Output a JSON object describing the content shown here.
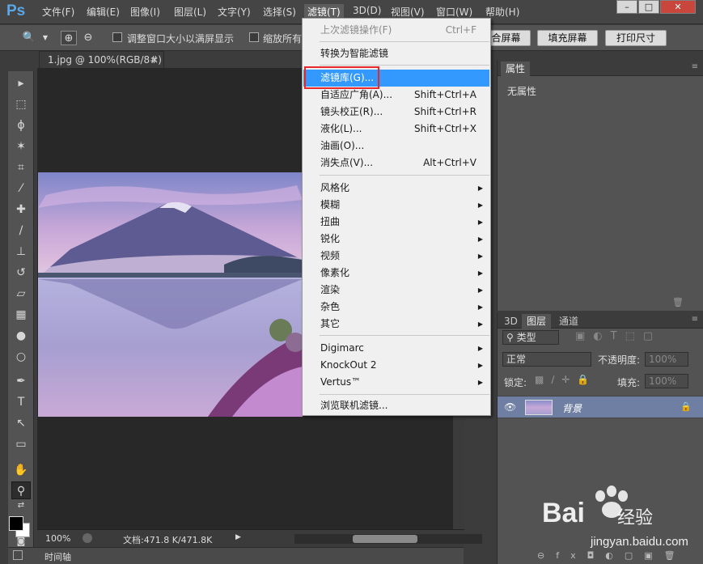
{
  "app": {
    "logo": "Ps",
    "menus": [
      "文件(F)",
      "编辑(E)",
      "图像(I)",
      "图层(L)",
      "文字(Y)",
      "选择(S)",
      "滤镜(T)",
      "3D(D)",
      "视图(V)",
      "窗口(W)",
      "帮助(H)"
    ]
  },
  "window_controls": {
    "minimize": "–",
    "maximize": "□",
    "close": "✕"
  },
  "options": {
    "zoom_icon": "🔍",
    "resize_label": "调整窗口大小以满屏显示",
    "zoom_all_label": "缩放所有",
    "fit_button": "合屏幕",
    "fill_button": "填充屏幕",
    "print_button": "打印尺寸"
  },
  "document": {
    "tab_title": "1.jpg @ 100%(RGB/8#)",
    "tab_close": "×"
  },
  "status": {
    "zoom": "100%",
    "doc_info": "文档:471.8 K/471.8K",
    "timeline": "时间轴"
  },
  "filter_menu": {
    "items": [
      {
        "label": "上次滤镜操作(F)",
        "shortcut": "Ctrl+F",
        "disabled": true
      },
      {
        "label": "转换为智能滤镜"
      },
      {
        "label": "滤镜库(G)...",
        "hover": true
      },
      {
        "label": "自适应广角(A)...",
        "shortcut": "Shift+Ctrl+A"
      },
      {
        "label": "镜头校正(R)...",
        "shortcut": "Shift+Ctrl+R"
      },
      {
        "label": "液化(L)...",
        "shortcut": "Shift+Ctrl+X"
      },
      {
        "label": "油画(O)..."
      },
      {
        "label": "消失点(V)...",
        "shortcut": "Alt+Ctrl+V"
      },
      {
        "label": "风格化",
        "submenu": true
      },
      {
        "label": "模糊",
        "submenu": true
      },
      {
        "label": "扭曲",
        "submenu": true
      },
      {
        "label": "锐化",
        "submenu": true
      },
      {
        "label": "视频",
        "submenu": true
      },
      {
        "label": "像素化",
        "submenu": true
      },
      {
        "label": "渲染",
        "submenu": true
      },
      {
        "label": "杂色",
        "submenu": true
      },
      {
        "label": "其它",
        "submenu": true
      },
      {
        "label": "Digimarc",
        "submenu": true
      },
      {
        "label": "KnockOut 2",
        "submenu": true
      },
      {
        "label": "Vertus™",
        "submenu": true
      },
      {
        "label": "浏览联机滤镜..."
      }
    ]
  },
  "properties_panel": {
    "tab": "属性",
    "content": "无属性"
  },
  "layers_panel": {
    "tabs": [
      "3D",
      "图层",
      "通道"
    ],
    "filter_label": "类型",
    "blend_mode": "正常",
    "opacity_label": "不透明度:",
    "opacity_value": "100%",
    "lock_label": "锁定:",
    "fill_label": "填充:",
    "fill_value": "100%",
    "layer_name": "背景"
  },
  "watermark": {
    "brand": "Bai",
    "brand_suffix": "经验",
    "url": "jingyan.baidu.com"
  },
  "colors": {
    "accent": "#3399ff",
    "highlight_box": "#e8282a",
    "layer_selected": "#6e7fa3"
  }
}
